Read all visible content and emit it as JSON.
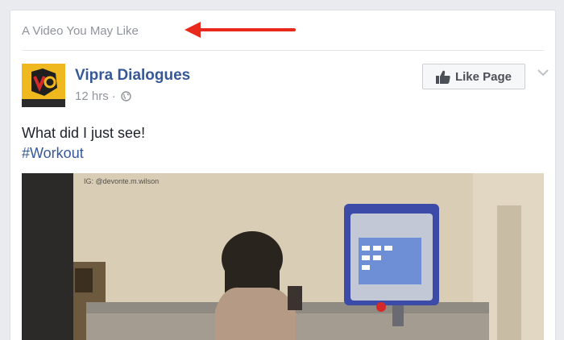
{
  "card": {
    "header_label": "A Video You May Like"
  },
  "post": {
    "page_name": "Vipra Dialogues",
    "time": "12 hrs",
    "separator": "·",
    "text": "What did I just see!",
    "hashtag": "#Workout",
    "like_page_label": "Like Page"
  },
  "video": {
    "watermark": "IG: @devonte.m.wilson"
  },
  "colors": {
    "link": "#365899",
    "annotation_arrow": "#e8291c",
    "muted": "#90949c"
  }
}
